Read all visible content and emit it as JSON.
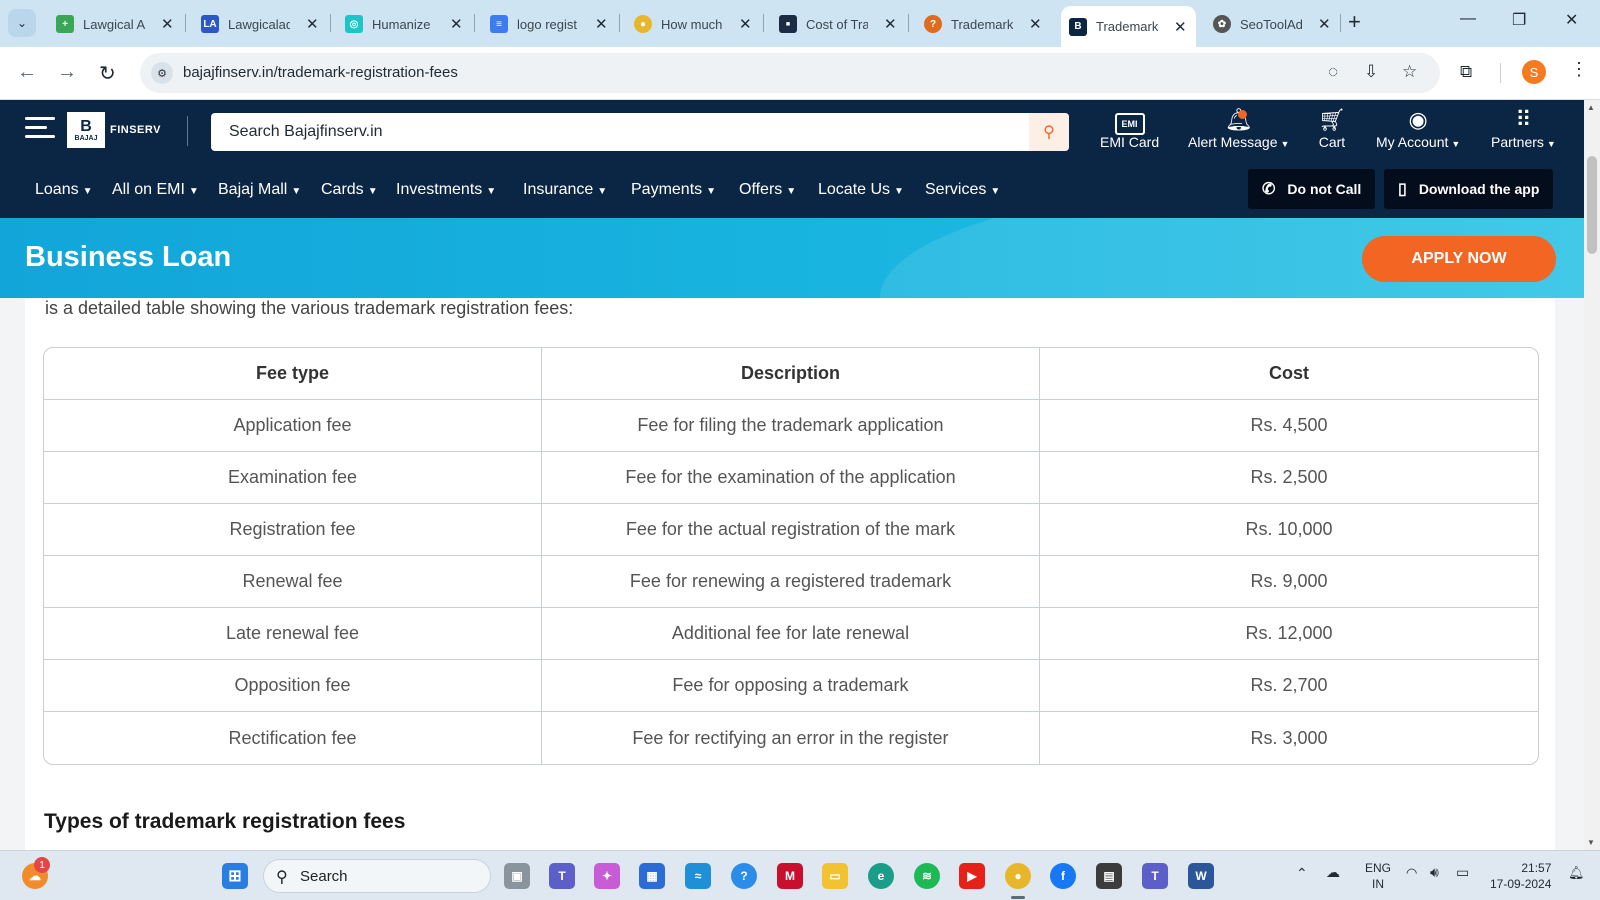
{
  "browser": {
    "tabs": [
      {
        "title": "Lawgical A",
        "favicon": "plus-icon",
        "color": "#3aa757",
        "active": false
      },
      {
        "title": "Lawgicalad",
        "favicon": "lawgical-icon",
        "color": "#2b57c9",
        "active": false
      },
      {
        "title": "Humanize",
        "favicon": "humanize-icon",
        "color": "#1cc6c6",
        "active": false
      },
      {
        "title": "logo regist",
        "favicon": "docs-icon",
        "color": "#3d7bf0",
        "active": false
      },
      {
        "title": "How much",
        "favicon": "chrome-icon",
        "color": "#e8b62b",
        "active": false
      },
      {
        "title": "Cost of Tra",
        "favicon": "site-icon",
        "color": "#1c2c44",
        "active": false
      },
      {
        "title": "Trademark",
        "favicon": "q-icon",
        "color": "#e06b1f",
        "active": false
      },
      {
        "title": "Trademark",
        "favicon": "bajaj-icon",
        "color": "#0b2545",
        "active": true
      },
      {
        "title": "SeoToolAd",
        "favicon": "openai-icon",
        "color": "#555555",
        "active": false
      }
    ],
    "url": "bajajfinserv.in/trademark-registration-fees"
  },
  "site": {
    "logo_letter": "B",
    "logo_small": "BAJAJ",
    "logo_text": "FINSERV",
    "search_placeholder": "Search Bajajfinserv.in",
    "header_items": {
      "emi_icon_text": "EMI",
      "emi_card": "EMI Card",
      "alert": "Alert Message",
      "cart": "Cart",
      "account": "My Account",
      "partners": "Partners"
    },
    "nav": [
      "Loans",
      "All on EMI",
      "Bajaj Mall",
      "Cards",
      "Investments",
      "Insurance",
      "Payments",
      "Offers",
      "Locate Us",
      "Services"
    ],
    "do_not_call": "Do not Call",
    "download_app": "Download the app",
    "banner_title": "Business Loan",
    "apply_now": "APPLY NOW"
  },
  "content": {
    "intro": "is a detailed table showing the various trademark registration fees:",
    "table": {
      "headers": [
        "Fee type",
        "Description",
        "Cost"
      ],
      "rows": [
        [
          "Application fee",
          "Fee for filing the trademark application",
          "Rs. 4,500"
        ],
        [
          "Examination fee",
          "Fee for the examination of the application",
          "Rs. 2,500"
        ],
        [
          "Registration fee",
          "Fee for the actual registration of the mark",
          "Rs. 10,000"
        ],
        [
          "Renewal fee",
          "Fee for renewing a registered trademark",
          "Rs. 9,000"
        ],
        [
          "Late renewal fee",
          "Additional fee for late renewal",
          "Rs. 12,000"
        ],
        [
          "Opposition fee",
          "Fee for opposing a trademark",
          "Rs. 2,700"
        ],
        [
          "Rectification fee",
          "Fee for rectifying an error in the register",
          "Rs. 3,000"
        ]
      ]
    },
    "next_heading": "Types of trademark registration fees"
  },
  "taskbar": {
    "search": "Search",
    "notification_count": "1",
    "chrome_badge": "S",
    "lang_line1": "ENG",
    "lang_line2": "IN",
    "time": "21:57",
    "date": "17-09-2024"
  },
  "colors": {
    "brand_navy": "#0b2545",
    "accent_orange": "#f26522",
    "banner_blue": "#19b5e0"
  }
}
